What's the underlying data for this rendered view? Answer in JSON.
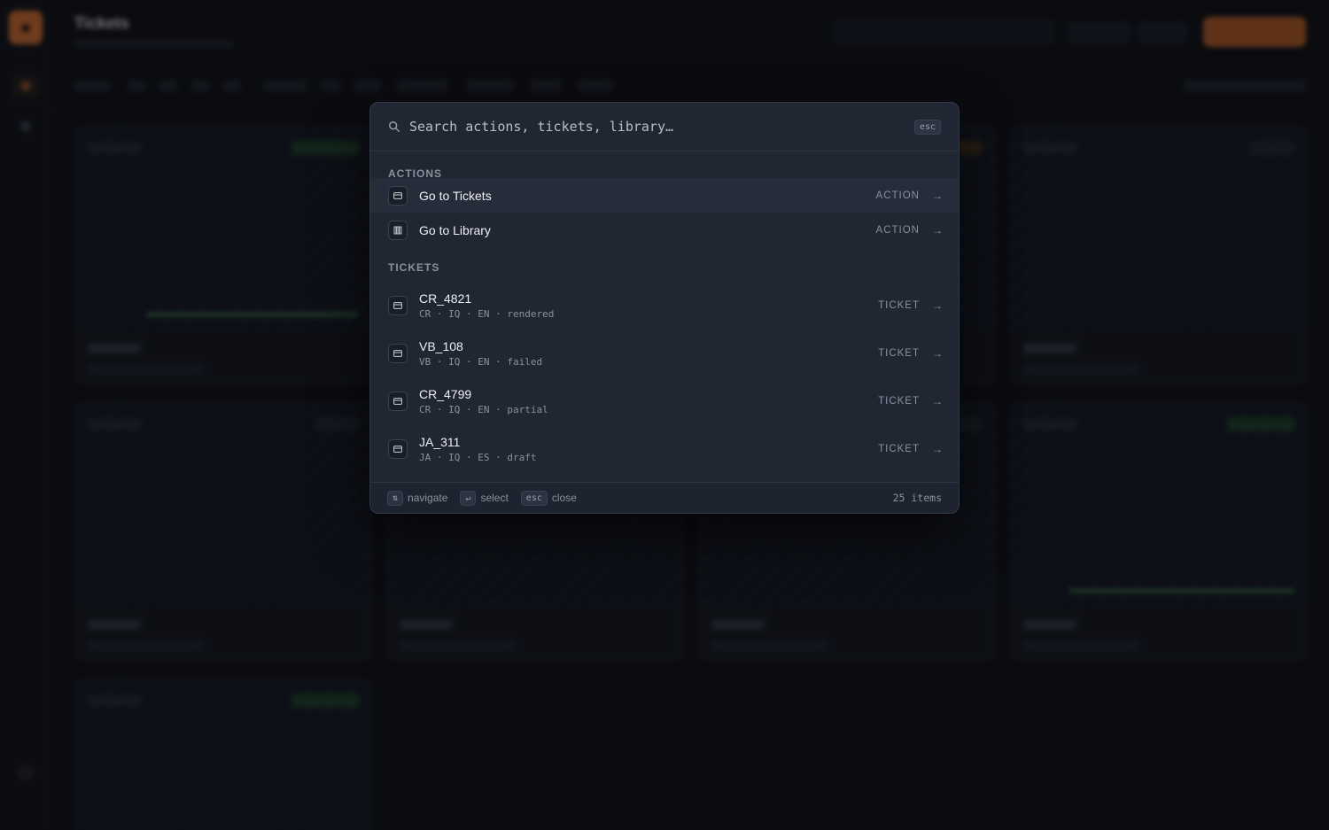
{
  "palette": {
    "search": {
      "placeholder": "Search actions, tickets, library…",
      "value": ""
    },
    "close_key": "esc",
    "sections": {
      "actions_label": "ACTIONS",
      "tickets_label": "TICKETS"
    },
    "actions": [
      {
        "label": "Go to Tickets",
        "kind": "ACTION",
        "icon": "ticket-icon"
      },
      {
        "label": "Go to Library",
        "kind": "ACTION",
        "icon": "library-icon"
      }
    ],
    "tickets": [
      {
        "label": "CR_4821",
        "meta": "CR · IQ · EN · rendered",
        "kind": "TICKET",
        "icon": "ticket-icon"
      },
      {
        "label": "VB_108",
        "meta": "VB · IQ · EN · failed",
        "kind": "TICKET",
        "icon": "ticket-icon"
      },
      {
        "label": "CR_4799",
        "meta": "CR · IQ · EN · partial",
        "kind": "TICKET",
        "icon": "ticket-icon"
      },
      {
        "label": "JA_311",
        "meta": "JA · IQ · ES · draft",
        "kind": "TICKET",
        "icon": "ticket-icon"
      }
    ],
    "arrow": "→",
    "footer": {
      "navigate_key": "⇅",
      "navigate_label": "navigate",
      "select_key": "↵",
      "select_label": "select",
      "close_key": "esc",
      "close_label": "close",
      "count": "25 items"
    }
  },
  "background": {
    "page_title": "Tickets"
  },
  "colors": {
    "accent": "#c0632a",
    "palette_bg": "#212633",
    "active_row": "#262c3a",
    "success": "#2f6d45"
  }
}
